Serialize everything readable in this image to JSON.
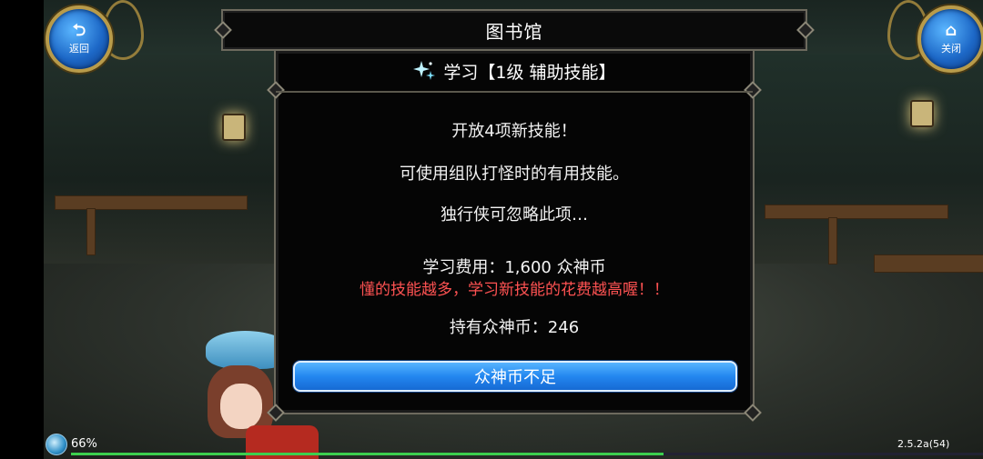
{
  "colors": {
    "accent": "#2387f0",
    "warning": "#ff5252",
    "panel": "#050505",
    "frame": "#6d6a5e"
  },
  "nav": {
    "back": {
      "icon": "back-arrow-icon",
      "label": "返回"
    },
    "close": {
      "icon": "home-icon",
      "label": "关闭"
    }
  },
  "title": "图书馆",
  "dialog": {
    "header_icon": "sparkle-icon",
    "header": "学习【1级  辅助技能】",
    "lines": [
      "开放4项新技能！",
      "可使用组队打怪时的有用技能。",
      "独行侠可忽略此项…"
    ],
    "cost_label": "学习费用：1,600 众神币",
    "warning": "懂的技能越多，学习新技能的花费越高喔！！",
    "held_label": "持有众神币：246",
    "button": "众神币不足"
  },
  "status": {
    "battery_icon": "status-orb-icon",
    "battery": "66%",
    "progress": 0.65,
    "version": "2.5.2a(54)"
  }
}
